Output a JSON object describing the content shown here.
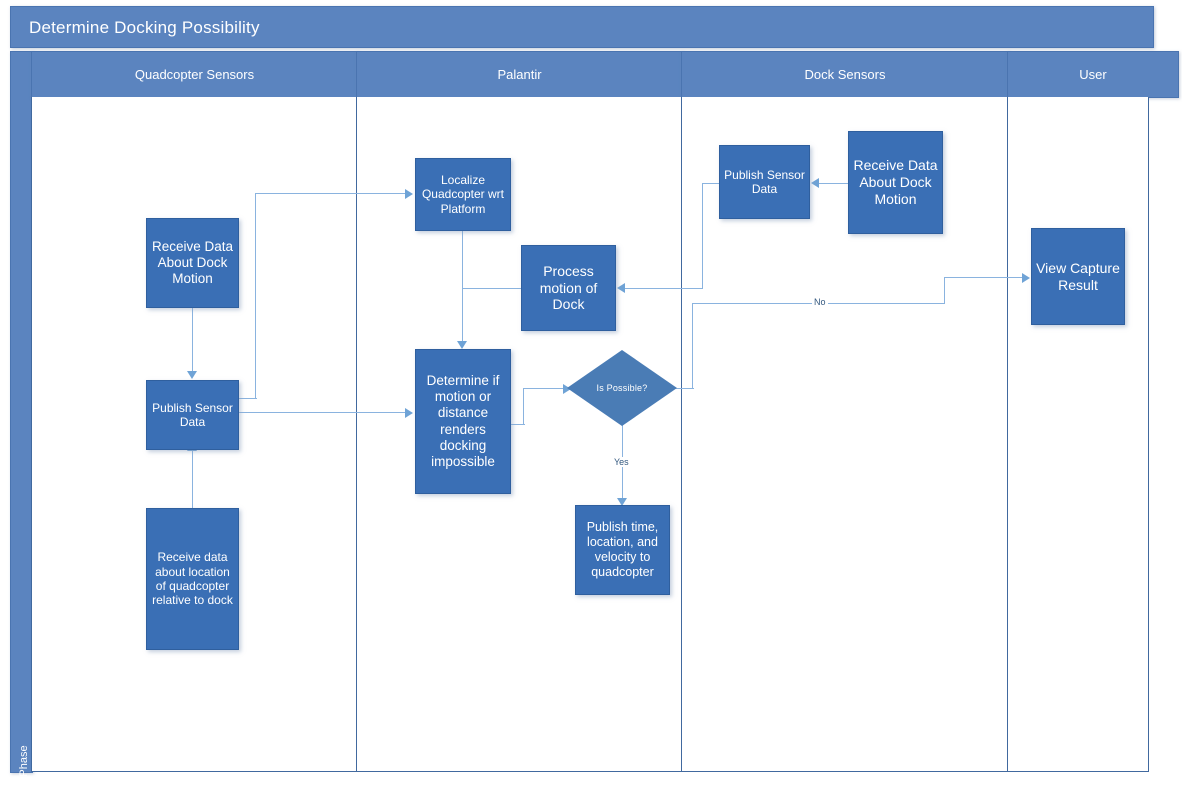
{
  "diagram": {
    "title": "Determine Docking Possibility",
    "phase_label": "Phase",
    "type": "cross-functional-flowchart",
    "colors": {
      "header_fill": "#5B84BF",
      "node_fill": "#3A6FB5",
      "decision_fill": "#4A7CB5",
      "connector": "#8AB3DF",
      "lane_border": "#41699F",
      "text": "#FFFFFF"
    }
  },
  "lanes": [
    {
      "id": "quadcopter",
      "label": "Quadcopter Sensors"
    },
    {
      "id": "palantir",
      "label": "Palantir"
    },
    {
      "id": "dock",
      "label": "Dock Sensors"
    },
    {
      "id": "user",
      "label": "User"
    }
  ],
  "nodes": [
    {
      "id": "q_receive",
      "lane": "quadcopter",
      "shape": "process",
      "label": "Receive Data About Dock Motion"
    },
    {
      "id": "q_publish",
      "lane": "quadcopter",
      "shape": "process",
      "label": "Publish Sensor Data"
    },
    {
      "id": "q_location",
      "lane": "quadcopter",
      "shape": "process",
      "label": "Receive data about location of quadcopter relative to dock"
    },
    {
      "id": "p_localize",
      "lane": "palantir",
      "shape": "process",
      "label": "Localize Quadcopter wrt Platform"
    },
    {
      "id": "p_process",
      "lane": "palantir",
      "shape": "process",
      "label": "Process motion of Dock"
    },
    {
      "id": "p_determine",
      "lane": "palantir",
      "shape": "process",
      "label": "Determine if motion or distance renders docking impossible"
    },
    {
      "id": "p_decision",
      "lane": "palantir",
      "shape": "decision",
      "label": "Is Possible?"
    },
    {
      "id": "p_publish",
      "lane": "palantir",
      "shape": "process",
      "label": "Publish time, location, and velocity to quadcopter"
    },
    {
      "id": "d_publish",
      "lane": "dock",
      "shape": "process",
      "label": "Publish Sensor Data"
    },
    {
      "id": "d_receive",
      "lane": "dock",
      "shape": "process",
      "label": "Receive Data About Dock Motion"
    },
    {
      "id": "u_view",
      "lane": "user",
      "shape": "process",
      "label": "View Capture Result"
    }
  ],
  "edges": [
    {
      "from": "q_receive",
      "to": "q_publish",
      "label": ""
    },
    {
      "from": "q_location",
      "to": "q_publish",
      "label": ""
    },
    {
      "from": "q_publish",
      "to": "p_localize",
      "label": ""
    },
    {
      "from": "q_publish",
      "to": "p_determine",
      "label": ""
    },
    {
      "from": "p_localize",
      "to": "p_determine",
      "label": ""
    },
    {
      "from": "p_localize",
      "to": "p_process",
      "label": ""
    },
    {
      "from": "p_determine",
      "to": "p_decision",
      "label": ""
    },
    {
      "from": "p_decision",
      "to": "p_publish",
      "label": "Yes"
    },
    {
      "from": "p_decision",
      "to": "u_view",
      "label": "No"
    },
    {
      "from": "d_receive",
      "to": "d_publish",
      "label": ""
    },
    {
      "from": "d_publish",
      "to": "p_process",
      "label": ""
    }
  ],
  "edge_labels": {
    "yes": "Yes",
    "no": "No"
  }
}
